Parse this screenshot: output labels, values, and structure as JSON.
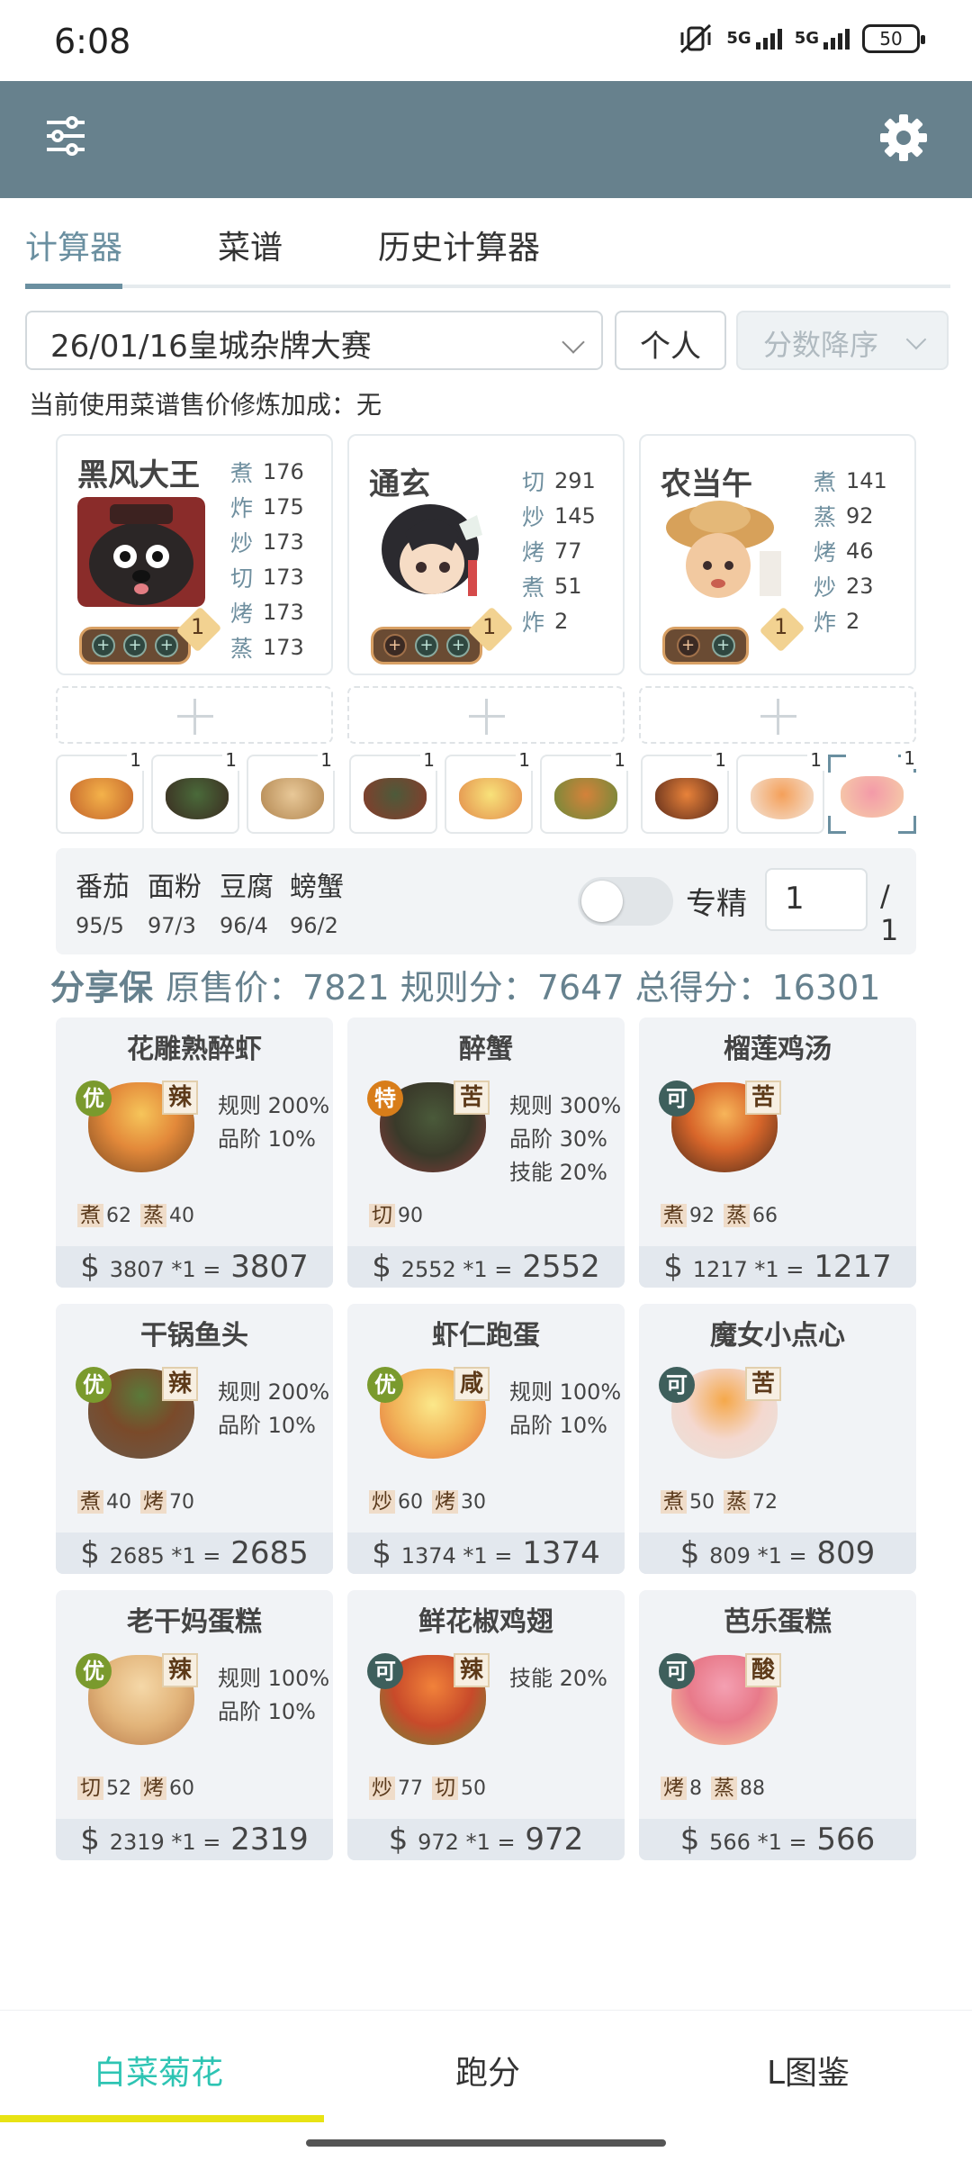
{
  "status": {
    "time": "6:08",
    "net1": "5G",
    "net2": "5G",
    "battery": "50"
  },
  "tabs": [
    {
      "label": "计算器"
    },
    {
      "label": "菜谱"
    },
    {
      "label": "历史计算器"
    }
  ],
  "filters": {
    "event": "26/01/16皇城杂牌大赛",
    "mode": "个人",
    "sort": "分数降序",
    "bonus_text": "当前使用菜谱售价修炼加成：无"
  },
  "chefs": [
    {
      "name": "黑风大王",
      "level": "1",
      "skills": [
        {
          "k": "煮",
          "v": "176"
        },
        {
          "k": "炸",
          "v": "175"
        },
        {
          "k": "炒",
          "v": "173"
        },
        {
          "k": "切",
          "v": "173"
        },
        {
          "k": "烤",
          "v": "173"
        },
        {
          "k": "蒸",
          "v": "173"
        }
      ]
    },
    {
      "name": "通玄",
      "level": "1",
      "skills": [
        {
          "k": "切",
          "v": "291"
        },
        {
          "k": "炒",
          "v": "145"
        },
        {
          "k": "烤",
          "v": "77"
        },
        {
          "k": "煮",
          "v": "51"
        },
        {
          "k": "炸",
          "v": "2"
        }
      ]
    },
    {
      "name": "农当午",
      "level": "1",
      "skills": [
        {
          "k": "煮",
          "v": "141"
        },
        {
          "k": "蒸",
          "v": "92"
        },
        {
          "k": "烤",
          "v": "46"
        },
        {
          "k": "炒",
          "v": "23"
        },
        {
          "k": "炸",
          "v": "2"
        }
      ]
    }
  ],
  "thumbs": [
    "1",
    "1",
    "1",
    "1",
    "1",
    "1",
    "1",
    "1",
    "1"
  ],
  "materials": [
    {
      "name": "番茄",
      "value": "95/5"
    },
    {
      "name": "面粉",
      "value": "97/3"
    },
    {
      "name": "豆腐",
      "value": "96/4"
    },
    {
      "name": "螃蟹",
      "value": "96/2"
    }
  ],
  "specialize": {
    "label": "专精",
    "value": "1",
    "total": "/ 1",
    "on": false
  },
  "summary": {
    "who": "分享保",
    "text": "原售价：7821 规则分：7647 总得分：16301"
  },
  "dishes": [
    {
      "name": "花雕熟醉虾",
      "rank": "优",
      "taste": "辣",
      "effects": [
        "规则 200%",
        "品阶 10%"
      ],
      "req": [
        [
          "煮",
          "62"
        ],
        [
          "蒸",
          "40"
        ]
      ],
      "price_small": "3807 *1 =",
      "price_total": "3807"
    },
    {
      "name": "醉蟹",
      "rank": "特",
      "taste": "苦",
      "effects": [
        "规则 300%",
        "品阶 30%",
        "技能 20%"
      ],
      "req": [
        [
          "切",
          "90"
        ]
      ],
      "price_small": "2552 *1 =",
      "price_total": "2552"
    },
    {
      "name": "榴莲鸡汤",
      "rank": "可",
      "taste": "苦",
      "effects": [],
      "req": [
        [
          "煮",
          "92"
        ],
        [
          "蒸",
          "66"
        ]
      ],
      "price_small": "1217 *1 =",
      "price_total": "1217"
    },
    {
      "name": "干锅鱼头",
      "rank": "优",
      "taste": "辣",
      "effects": [
        "规则 200%",
        "品阶 10%"
      ],
      "req": [
        [
          "煮",
          "40"
        ],
        [
          "烤",
          "70"
        ]
      ],
      "price_small": "2685 *1 =",
      "price_total": "2685"
    },
    {
      "name": "虾仁跑蛋",
      "rank": "优",
      "taste": "咸",
      "effects": [
        "规则 100%",
        "品阶 10%"
      ],
      "req": [
        [
          "炒",
          "60"
        ],
        [
          "烤",
          "30"
        ]
      ],
      "price_small": "1374 *1 =",
      "price_total": "1374"
    },
    {
      "name": "魔女小点心",
      "rank": "可",
      "taste": "苦",
      "effects": [],
      "req": [
        [
          "煮",
          "50"
        ],
        [
          "蒸",
          "72"
        ]
      ],
      "price_small": "809 *1 =",
      "price_total": "809"
    },
    {
      "name": "老干妈蛋糕",
      "rank": "优",
      "taste": "辣",
      "effects": [
        "规则 100%",
        "品阶 10%"
      ],
      "req": [
        [
          "切",
          "52"
        ],
        [
          "烤",
          "60"
        ]
      ],
      "price_small": "2319 *1 =",
      "price_total": "2319"
    },
    {
      "name": "鲜花椒鸡翅",
      "rank": "可",
      "taste": "辣",
      "effects": [
        "技能 20%"
      ],
      "req": [
        [
          "炒",
          "77"
        ],
        [
          "切",
          "50"
        ]
      ],
      "price_small": "972 *1 =",
      "price_total": "972"
    },
    {
      "name": "芭乐蛋糕",
      "rank": "可",
      "taste": "酸",
      "effects": [],
      "req": [
        [
          "烤",
          "8"
        ],
        [
          "蒸",
          "88"
        ]
      ],
      "price_small": "566 *1 =",
      "price_total": "566"
    }
  ],
  "bottom_nav": [
    {
      "label": "白菜菊花"
    },
    {
      "label": "跑分"
    },
    {
      "label": "L图鉴"
    }
  ],
  "colors": {
    "appbar": "#67818d",
    "accent": "#6a8fa0",
    "nav_active": "#2ec4b3",
    "rank_you": "#7a9a2d",
    "rank_te": "#d87d1a",
    "rank_ke": "#3e5f5c"
  }
}
